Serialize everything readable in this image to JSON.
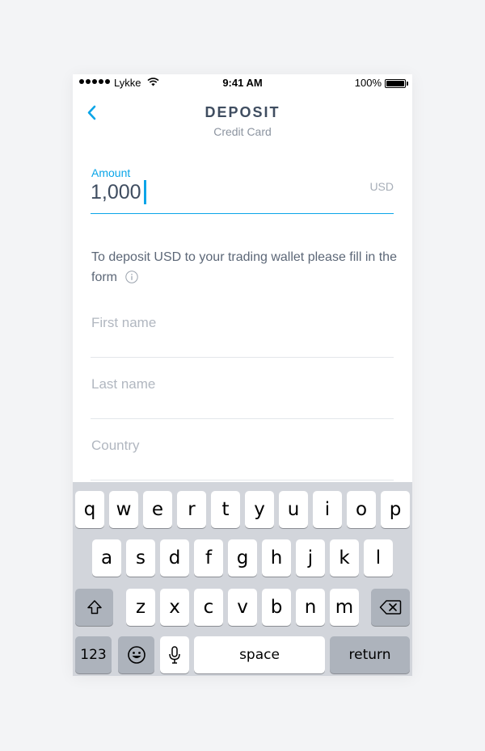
{
  "status_bar": {
    "carrier": "Lykke",
    "time": "9:41 AM",
    "battery": "100%"
  },
  "nav": {
    "title": "DEPOSIT",
    "subtitle": "Credit Card",
    "back_icon": "chevron-left-icon"
  },
  "amount": {
    "label": "Amount",
    "value": "1,000",
    "currency": "USD"
  },
  "instructions": {
    "text": "To deposit USD to your trading wallet please fill in the form",
    "icon": "info-icon"
  },
  "form": {
    "first_name_placeholder": "First name",
    "last_name_placeholder": "Last name",
    "country_placeholder": "Country"
  },
  "keyboard": {
    "row1": [
      "q",
      "w",
      "e",
      "r",
      "t",
      "y",
      "u",
      "i",
      "o",
      "p"
    ],
    "row2": [
      "a",
      "s",
      "d",
      "f",
      "g",
      "h",
      "j",
      "k",
      "l"
    ],
    "row3": [
      "z",
      "x",
      "c",
      "v",
      "b",
      "n",
      "m"
    ],
    "numbers_label": "123",
    "space_label": "space",
    "return_label": "return"
  },
  "colors": {
    "accent": "#0aa5e8",
    "title": "#3f4d60",
    "keyboard_bg": "#d2d5db"
  }
}
